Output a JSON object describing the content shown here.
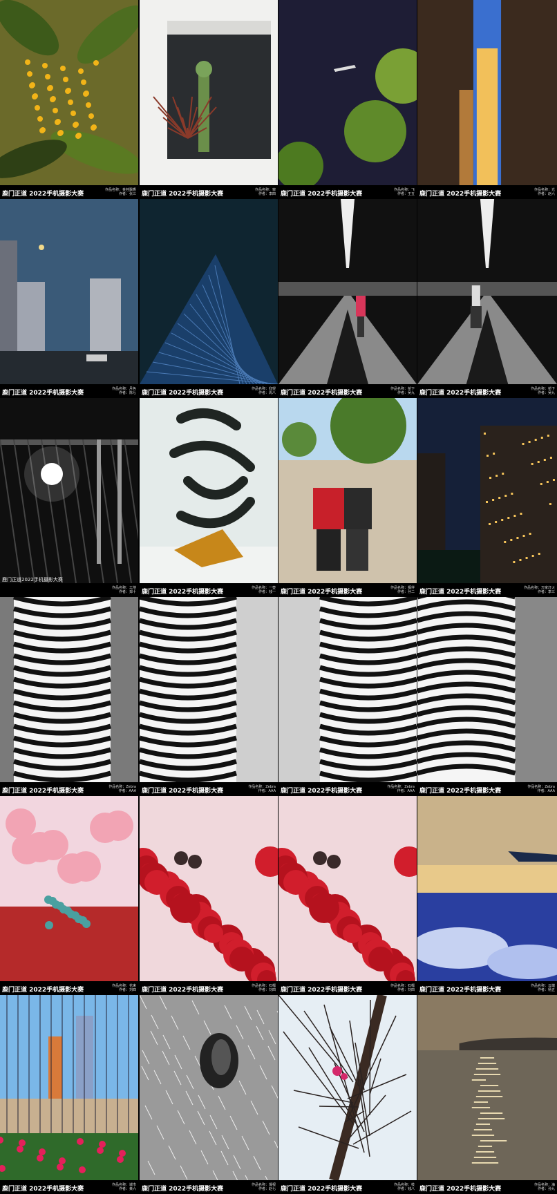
{
  "gallery": {
    "tiles": [
      {
        "caption": "鹿门正道 2022手机摄影大赛",
        "meta": [
          "作品名称：金桂飘香",
          "作者：张三"
        ],
        "scene": "osmanthus"
      },
      {
        "caption": "鹿门正道 2022手机摄影大赛",
        "meta": [
          "作品名称：窗",
          "作者：李四"
        ],
        "scene": "window"
      },
      {
        "caption": "鹿门正道 2022手机摄影大赛",
        "meta": [
          "作品名称：飞",
          "作者：王五"
        ],
        "scene": "plane"
      },
      {
        "caption": "鹿门正道 2022手机摄影大赛",
        "meta": [
          "作品名称：光",
          "作者：赵六"
        ],
        "scene": "alley"
      },
      {
        "caption": "鹿门正道 2022手机摄影大赛",
        "meta": [
          "作品名称：月色",
          "作者：陈七"
        ],
        "scene": "moon"
      },
      {
        "caption": "鹿门正道 2022手机摄影大赛",
        "meta": [
          "作品名称：仰望",
          "作者：周八"
        ],
        "scene": "tower"
      },
      {
        "caption": "鹿门正道 2022手机摄影大赛",
        "meta": [
          "作品名称：桥下",
          "作者：吴九"
        ],
        "scene": "bridge-red"
      },
      {
        "caption": "鹿门正道 2022手机摄影大赛",
        "meta": [
          "作品名称：桥下",
          "作者：吴九"
        ],
        "scene": "bridge-walker"
      },
      {
        "caption": "鹿门正道2022手机摄影大赛",
        "meta": [
          "作品名称：工地",
          "作者：郑十"
        ],
        "scene": "construction",
        "alt": true
      },
      {
        "caption": "鹿门正道 2022手机摄影大赛",
        "meta": [
          "作品名称：一壶",
          "作者：钱一"
        ],
        "scene": "calligraphy"
      },
      {
        "caption": "鹿门正道 2022手机摄影大赛",
        "meta": [
          "作品名称：相伴",
          "作者：孙二"
        ],
        "scene": "couple"
      },
      {
        "caption": "鹿门正道 2022手机摄影大赛",
        "meta": [
          "作品名称：万家灯火",
          "作者：李三"
        ],
        "scene": "night-city"
      },
      {
        "caption": "鹿门正道 2022手机摄影大赛",
        "meta": [
          "作品名称：Zebra",
          "作者：AAA"
        ],
        "scene": "zebra1"
      },
      {
        "caption": "鹿门正道 2022手机摄影大赛",
        "meta": [
          "作品名称：Zebra",
          "作者：AAA"
        ],
        "scene": "zebra2"
      },
      {
        "caption": "鹿门正道 2022手机摄影大赛",
        "meta": [
          "作品名称：Zebra",
          "作者：AAA"
        ],
        "scene": "zebra3"
      },
      {
        "caption": "鹿门正道 2022手机摄影大赛",
        "meta": [
          "作品名称：Zebra",
          "作者：AAA"
        ],
        "scene": "zebra4"
      },
      {
        "caption": "鹿门正道 2022手机摄影大赛",
        "meta": [
          "作品名称：花束",
          "作者：刘四"
        ],
        "scene": "bouquet"
      },
      {
        "caption": "鹿门正道 2022手机摄影大赛",
        "meta": [
          "作品名称：石榴",
          "作者：刘四"
        ],
        "scene": "pomegranate"
      },
      {
        "caption": "鹿门正道 2022手机摄影大赛",
        "meta": [
          "作品名称：石榴",
          "作者：刘四"
        ],
        "scene": "pomegranate"
      },
      {
        "caption": "鹿门正道 2022手机摄影大赛",
        "meta": [
          "作品名称：云端",
          "作者：杨五"
        ],
        "scene": "sky-wing"
      },
      {
        "caption": "鹿门正道 2022手机摄影大赛",
        "meta": [
          "作品名称：城市",
          "作者：黄六"
        ],
        "scene": "city-flowers"
      },
      {
        "caption": "鹿门正道 2022手机摄影大赛",
        "meta": [
          "作品名称：凝视",
          "作者：赵七"
        ],
        "scene": "cat-eye"
      },
      {
        "caption": "鹿门正道 2022手机摄影大赛",
        "meta": [
          "作品名称：枝",
          "作者：钱八"
        ],
        "scene": "branches"
      },
      {
        "caption": "鹿门正道 2022手机摄影大赛",
        "meta": [
          "作品名称：海",
          "作者：孙九"
        ],
        "scene": "sea"
      }
    ]
  },
  "colors": {
    "background": "#000000",
    "caption_text": "#ffffff"
  }
}
